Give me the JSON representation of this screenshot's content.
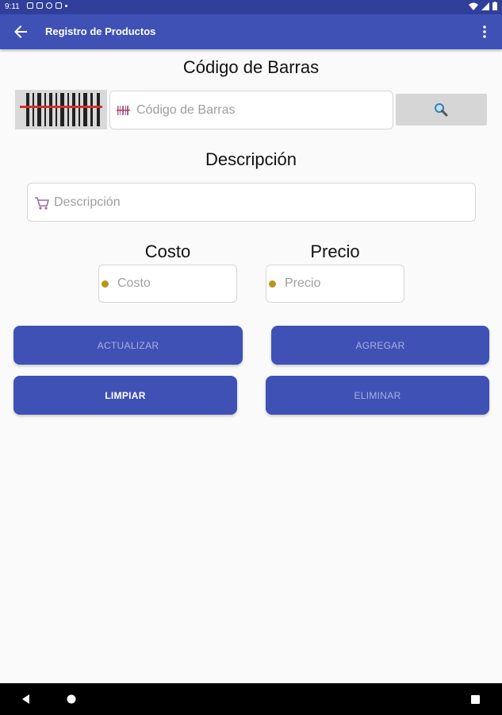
{
  "status_bar": {
    "time": "9:11"
  },
  "app_bar": {
    "title": "Registro de Productos"
  },
  "barcode_section": {
    "title": "Código de Barras",
    "placeholder": "Código de Barras",
    "search_icon": "search-icon",
    "scanner_icon": "barcode-scanner-icon"
  },
  "description_section": {
    "title": "Descripción",
    "placeholder": "Descripción",
    "icon": "cart-icon"
  },
  "cost_section": {
    "title": "Costo",
    "placeholder": "Costo"
  },
  "price_section": {
    "title": "Precio",
    "placeholder": "Precio"
  },
  "buttons": {
    "update": "ACTUALIZAR",
    "add": "AGREGAR",
    "clear": "LIMPIAR",
    "delete": "ELIMINAR"
  },
  "colors": {
    "app_bar": "#3f51b5",
    "status_bar": "#2f3f9a",
    "button": "#3f51b5",
    "dot": "#b8961e",
    "scanner_line": "#d32f2f"
  }
}
